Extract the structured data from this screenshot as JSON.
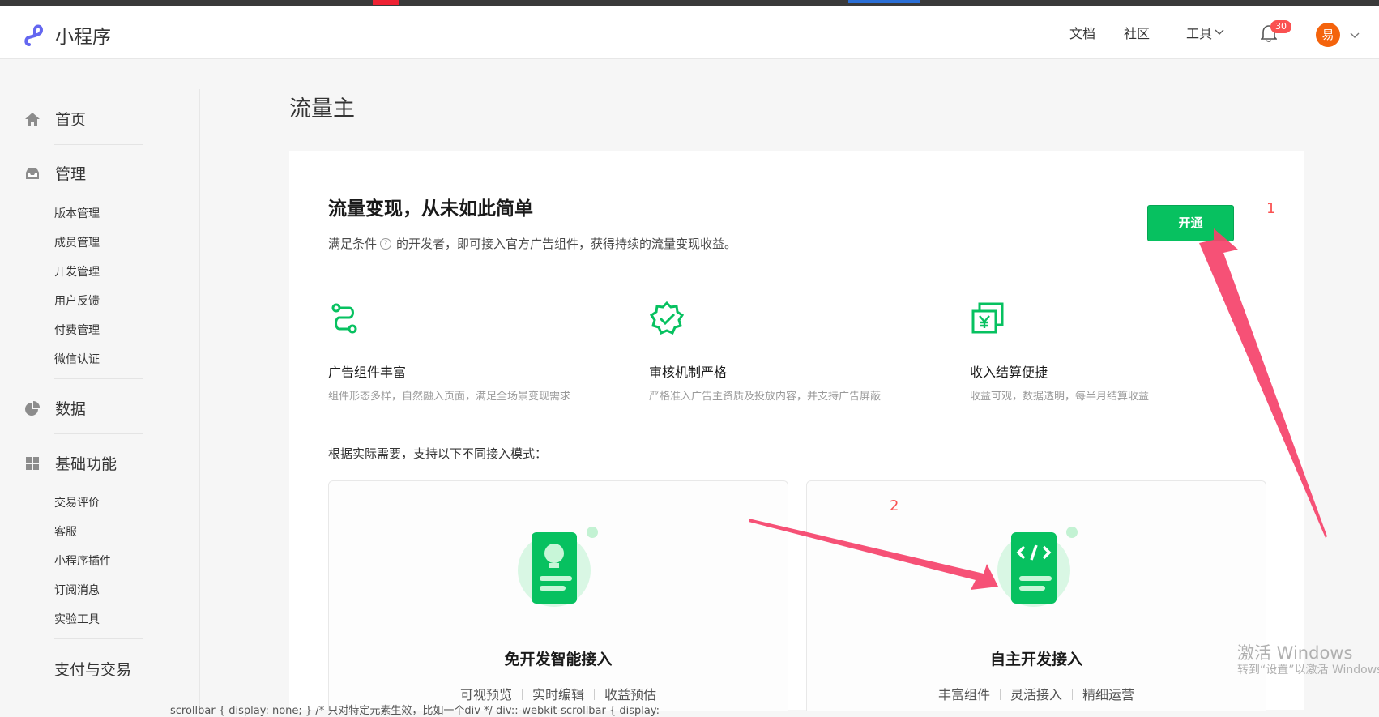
{
  "header": {
    "logo_text": "小程序",
    "nav": [
      "文档",
      "社区",
      "工具"
    ],
    "badge_count": "30",
    "avatar_text": "易"
  },
  "sidebar": {
    "home": "首页",
    "manage": "管理",
    "manage_items": [
      "版本管理",
      "成员管理",
      "开发管理",
      "用户反馈",
      "付费管理",
      "微信认证"
    ],
    "data": "数据",
    "basic": "基础功能",
    "basic_items": [
      "交易评价",
      "客服",
      "小程序插件",
      "订阅消息",
      "实验工具"
    ],
    "pay": "支付与交易"
  },
  "page": {
    "title": "流量主",
    "headline": "流量变现，从未如此简单",
    "desc_a": "满足条件",
    "desc_b": "的开发者，即可接入官方广告组件，获得持续的流量变现收益。",
    "open_button": "开通",
    "features": [
      {
        "title": "广告组件丰富",
        "desc": "组件形态多样，自然融入页面，满足全场景变现需求"
      },
      {
        "title": "审核机制严格",
        "desc": "严格准入广告主资质及投放内容，并支持广告屏蔽"
      },
      {
        "title": "收入结算便捷",
        "desc": "收益可观，数据透明，每半月结算收益"
      }
    ],
    "modes_label": "根据实际需要，支持以下不同接入模式：",
    "mode_cards": [
      {
        "title": "免开发智能接入",
        "tags": [
          "可视预览",
          "实时编辑",
          "收益预估"
        ]
      },
      {
        "title": "自主开发接入",
        "tags": [
          "丰富组件",
          "灵活接入",
          "精细运营"
        ]
      }
    ]
  },
  "annotations": {
    "one": "1",
    "two": "2"
  },
  "watermark": {
    "line1": "激活 Windows",
    "line2": "转到“设置”以激活 Windows"
  },
  "bottom_text": "scrollbar { display: none; } /* 只对特定元素生效，比如一个div */ div::-webkit-scrollbar { display:",
  "colors": {
    "accent": "#07c160",
    "badge": "#fa5151",
    "avatar": "#f4630c",
    "annotation": "#f5426a"
  }
}
